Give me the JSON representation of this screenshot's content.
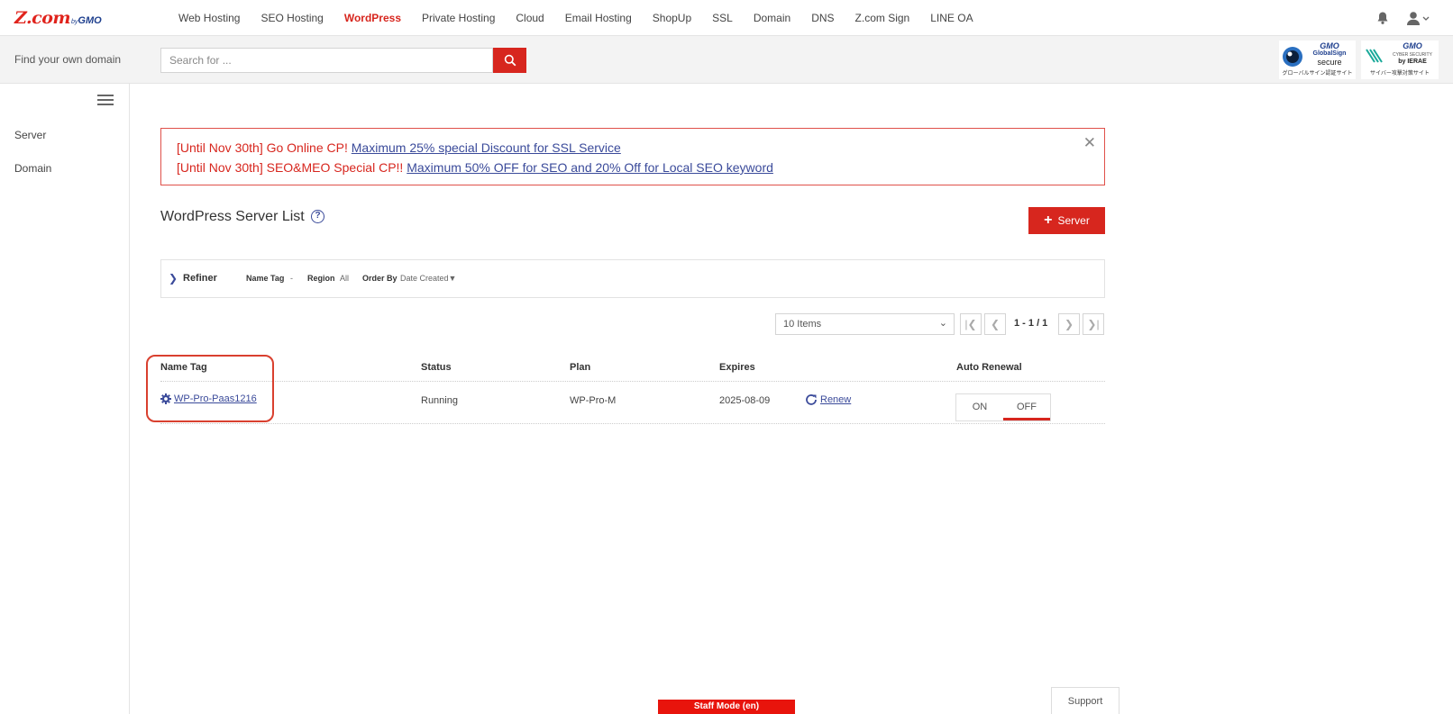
{
  "header": {
    "logo": {
      "main": "Z.com",
      "by": "by",
      "gmo": "GMO"
    },
    "nav": [
      "Web Hosting",
      "SEO Hosting",
      "WordPress",
      "Private Hosting",
      "Cloud",
      "Email Hosting",
      "ShopUp",
      "SSL",
      "Domain",
      "DNS",
      "Z.com Sign",
      "LINE OA"
    ],
    "active_nav": "WordPress",
    "icons": [
      "bell-icon",
      "user-icon"
    ]
  },
  "search": {
    "label": "Find your own domain",
    "placeholder": "Search for ...",
    "value": "",
    "button_icon": "search-icon"
  },
  "badges": {
    "globalsign": {
      "brand": "GMO",
      "name": "GlobalSign",
      "sub": "secure",
      "caption": "グローバルサイン認証サイト"
    },
    "ierae": {
      "brand": "GMO",
      "name": "CYBER SECURITY",
      "sub": "by IERAE",
      "caption": "サイバー攻撃対策サイト"
    }
  },
  "sidebar": {
    "items": [
      {
        "label": "Server"
      },
      {
        "label": "Domain"
      }
    ]
  },
  "alert": {
    "line1_prefix": "[Until Nov 30th] Go Online CP! ",
    "line1_link": "Maximum 25% special Discount for SSL Service",
    "line2_prefix": "[Until Nov 30th] SEO&MEO Special CP!! ",
    "line2_link": "Maximum 50% OFF for SEO and 20% Off for Local SEO keyword",
    "close": "✕"
  },
  "page": {
    "title": "WordPress Server List",
    "help": "?",
    "add_button": "Server"
  },
  "refiner": {
    "title": "Refiner",
    "filters": [
      {
        "key": "Name Tag",
        "value": "-"
      },
      {
        "key": "Region",
        "value": "All"
      },
      {
        "key": "Order By",
        "value": "Date Created▼"
      }
    ]
  },
  "pagination": {
    "items_per_page": "10 Items",
    "range": "1 - 1 / 1"
  },
  "table": {
    "headers": [
      "Name Tag",
      "Status",
      "Plan",
      "Expires",
      "Auto Renewal"
    ],
    "rows": [
      {
        "name_tag": "WP-Pro-Paas1216",
        "status": "Running",
        "plan": "WP-Pro-M",
        "expires": "2025-08-09",
        "renew": "Renew",
        "auto_renewal_on": "ON",
        "auto_renewal_off": "OFF",
        "auto_renewal_selected": "OFF"
      }
    ]
  },
  "footer": {
    "staff_mode": "Staff Mode (en)",
    "support": "Support"
  },
  "colors": {
    "accent": "#d7261e",
    "link": "#3a4a9a",
    "brand_blue": "#1e3f8e"
  }
}
